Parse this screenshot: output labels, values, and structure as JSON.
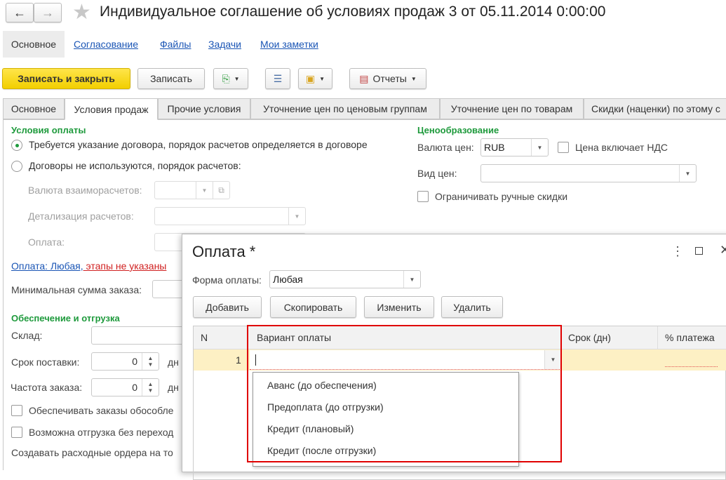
{
  "window": {
    "title": "Индивидуальное соглашение об условиях продаж 3 от 05.11.2014 0:00:00",
    "back_icon": "arrow-left-icon",
    "forward_icon": "arrow-right-icon",
    "star_icon": "star-icon"
  },
  "nav": {
    "items": [
      "Основное",
      "Согласование",
      "Файлы",
      "Задачи",
      "Мои заметки"
    ]
  },
  "toolbar": {
    "save_close": "Записать и закрыть",
    "save": "Записать",
    "reports": "Отчеты",
    "accent": "#f5d40f"
  },
  "tabs": [
    "Основное",
    "Условия продаж",
    "Прочие условия",
    "Уточнение цен по ценовым группам",
    "Уточнение цен по товарам",
    "Скидки (наценки) по этому с"
  ],
  "payment": {
    "header": "Условия оплаты",
    "radio1": "Требуется указание договора, порядок расчетов определяется в договоре",
    "radio2": "Договоры не используются, порядок расчетов:",
    "currency_label": "Валюта взаиморасчетов:",
    "detail_label": "Детализация расчетов:",
    "pay_label": "Оплата:",
    "link_blue": "Оплата: Любая,",
    "link_red": " этапы не указаны",
    "min_sum_label": "Минимальная сумма заказа:"
  },
  "shipping": {
    "header": "Обеспечение и отгрузка",
    "warehouse_label": "Склад:",
    "delivery_label": "Срок поставки:",
    "delivery_value": "0",
    "days": "дн",
    "freq_label": "Частота заказа:",
    "freq_value": "0",
    "cb1": "Обеспечивать заказы обособле",
    "cb2": "Возможна отгрузка без переход",
    "create_orders": "Создавать расходные ордера на то"
  },
  "pricing": {
    "header": "Ценообразование",
    "currency_label": "Валюта цен:",
    "currency_value": "RUB",
    "vat_label": "Цена включает НДС",
    "price_type_label": "Вид цен:",
    "limit_label": "Ограничивать ручные скидки"
  },
  "dialog": {
    "title": "Оплата *",
    "form_label": "Форма оплаты:",
    "form_value": "Любая",
    "buttons": [
      "Добавить",
      "Скопировать",
      "Изменить",
      "Удалить"
    ],
    "columns": [
      "N",
      "Вариант оплаты",
      "Срок (дн)",
      "% платежа"
    ],
    "row_n": "1",
    "options": [
      "Аванс (до обеспечения)",
      "Предоплата (до отгрузки)",
      "Кредит (плановый)",
      "Кредит (после отгрузки)"
    ],
    "highlight_color": "#e00000",
    "row_color": "#fdf0c4"
  }
}
